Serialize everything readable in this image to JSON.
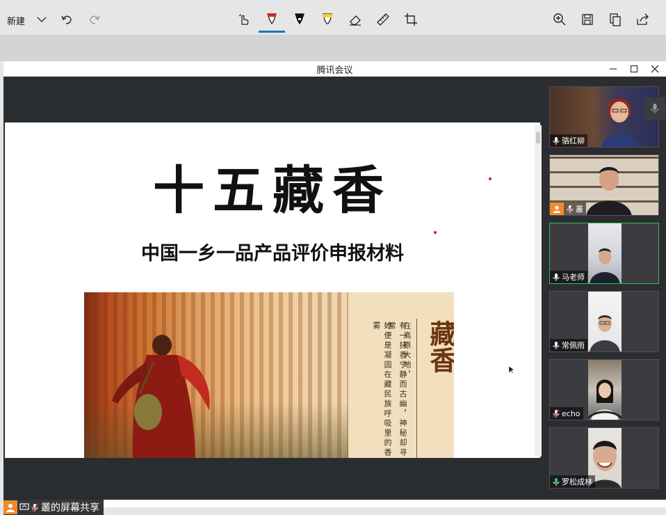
{
  "toolbar": {
    "new_label": "新建",
    "accent": "#1a73c9",
    "icons": [
      "chevron-down-icon",
      "undo-icon",
      "redo-icon",
      "touch-writing-icon",
      "ballpoint-pen-icon",
      "pencil-icon",
      "highlighter-icon",
      "eraser-icon",
      "ruler-icon",
      "crop-icon",
      "zoom-in-icon",
      "save-icon",
      "copy-icon",
      "share-icon"
    ]
  },
  "window": {
    "title": "腾讯会议"
  },
  "slide": {
    "title": "十五藏香",
    "subtitle": "中国一乡一品产品评价申报材料",
    "image": {
      "heading": "藏香",
      "poem_lines": [
        "在高原大地，",
        "有一抹香宁静而古幽，神秘却寻常",
        "她便是凝固在藏民族呼吸里的香雾"
      ]
    }
  },
  "share_label": "叢的屏幕共享",
  "participants": [
    {
      "name": "骆红柳",
      "mic": "on",
      "speaking": false
    },
    {
      "name": "叢",
      "mic": "muted",
      "speaking": false
    },
    {
      "name": "马老师",
      "mic": "on",
      "speaking": true
    },
    {
      "name": "常佩雨",
      "mic": "on",
      "speaking": false
    },
    {
      "name": "echo",
      "mic": "muted",
      "speaking": false
    },
    {
      "name": "罗松成林",
      "mic": "active",
      "speaking": false
    }
  ],
  "colors": {
    "panel_bg": "#2b2d31",
    "active_border": "#2ec45a",
    "avatar_orange": "#f28a2b",
    "muted_red": "#e33a3a"
  }
}
